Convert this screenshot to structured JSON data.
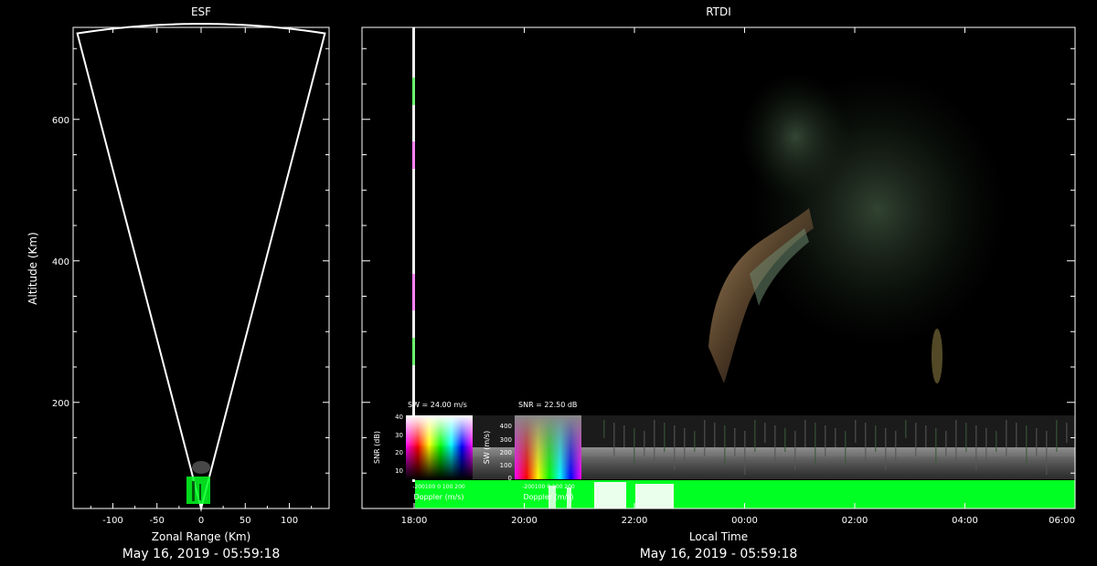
{
  "chart_data": [
    {
      "type": "scatter",
      "title": "ESF",
      "xlabel": "Zonal Range (Km)",
      "ylabel": "Altitude (Km)",
      "xlim": [
        -145,
        145
      ],
      "ylim": [
        50,
        730
      ],
      "x_ticks": [
        -100,
        -50,
        0,
        50,
        100
      ],
      "y_ticks": [
        200,
        400,
        600
      ],
      "x_tick_labels": [
        "-100",
        "-50",
        "0",
        "50",
        "100"
      ],
      "y_tick_labels": [
        "200",
        "400",
        "600"
      ],
      "fan": {
        "half_angle_deg": 11,
        "max_range_km": 735
      },
      "footer": "May 16, 2019 - 05:59:18"
    },
    {
      "type": "heatmap",
      "title": "RTDI",
      "xlabel": "Local Time",
      "x_tick_labels": [
        "18:00",
        "20:00",
        "22:00",
        "00:00",
        "02:00",
        "04:00",
        "06:00"
      ],
      "y_tick_values": [
        200,
        400,
        600
      ],
      "ylim": [
        50,
        730
      ],
      "footer": "May 16, 2019 - 05:59:18"
    }
  ],
  "legends": [
    {
      "title": "SW = 24.00 m/s",
      "ylabel": "SNR (dB)",
      "y_tick_labels": [
        "40",
        "30",
        "20",
        "10"
      ],
      "x_tick_text": "-200100  0  100 200",
      "xlabel": "Doppler (m/s)"
    },
    {
      "title": "SNR = 22.50 dB",
      "ylabel": "SW (m/s)",
      "y_tick_labels": [
        "400",
        "300",
        "200",
        "100",
        "0"
      ],
      "x_tick_text": "-200100  0  100 200",
      "xlabel": "Doppler (m/s)"
    }
  ]
}
